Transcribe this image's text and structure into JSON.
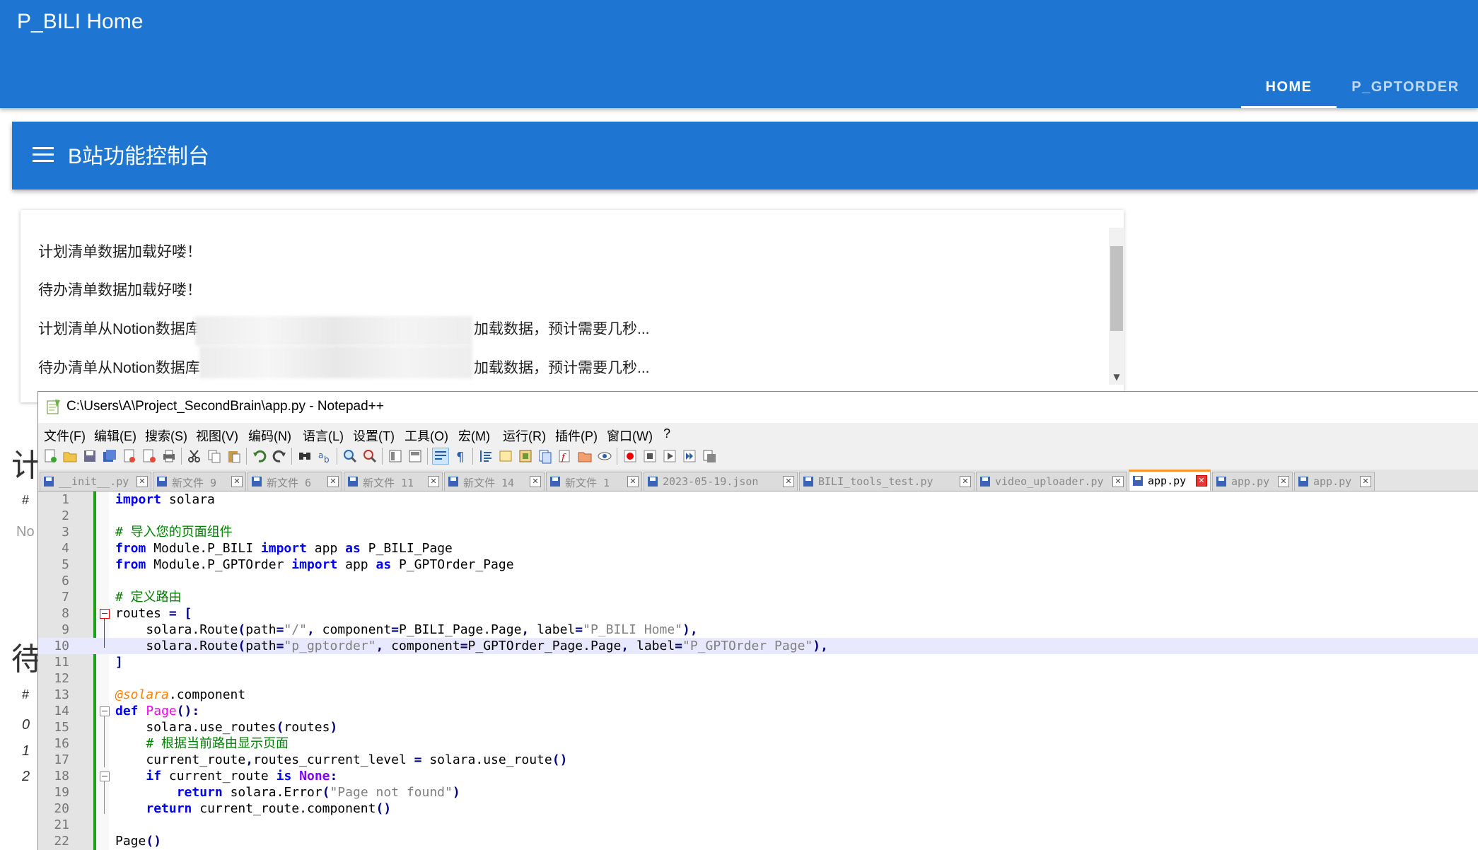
{
  "app": {
    "title": "P_BILI Home"
  },
  "nav": {
    "tabs": [
      {
        "label": "HOME"
      },
      {
        "label": "P_GPTORDER"
      }
    ]
  },
  "toolbar": {
    "title": "B站功能控制台"
  },
  "log": {
    "lines": [
      "计划清单数据加载好喽！",
      "待办清单数据加载好喽！",
      "计划清单从Notion数据库",
      "待办清单从Notion数据库"
    ],
    "line_tails": [
      "加载数据，预计需要几秒...",
      "加载数据，预计需要几秒..."
    ]
  },
  "background_fragments": {
    "heading_1": "计",
    "hash_1": "#",
    "no_1": "No",
    "heading_2": "待",
    "hash_2": "#",
    "rows": [
      "0",
      "1",
      "2"
    ]
  },
  "notepad": {
    "title": "C:\\Users\\A\\Project_SecondBrain\\app.py - Notepad++",
    "menu": [
      "文件(F)",
      "编辑(E)",
      "搜索(S)",
      "视图(V)",
      "编码(N)",
      "语言(L)",
      "设置(T)",
      "工具(O)",
      "宏(M)",
      "运行(R)",
      "插件(P)",
      "窗口(W)",
      "?"
    ],
    "tabs": [
      {
        "name": "__init__.py"
      },
      {
        "name": "新文件 9"
      },
      {
        "name": "新文件 6"
      },
      {
        "name": "新文件 11"
      },
      {
        "name": "新文件 14"
      },
      {
        "name": "新文件 1"
      },
      {
        "name": "2023-05-19.json"
      },
      {
        "name": "BILI_tools_test.py"
      },
      {
        "name": "video_uploader.py"
      },
      {
        "name": "app.py",
        "active": true
      },
      {
        "name": "app.py"
      },
      {
        "name": "app.py"
      }
    ],
    "line_numbers": [
      "1",
      "2",
      "3",
      "4",
      "5",
      "6",
      "7",
      "8",
      "9",
      "10",
      "11",
      "12",
      "13",
      "14",
      "15",
      "16",
      "17",
      "18",
      "19",
      "20",
      "21",
      "22"
    ],
    "highlighted_line": 10
  },
  "colors": {
    "primary": "#1e76d2",
    "active_tab_border": "#fa9628",
    "change_bar": "#17a517"
  }
}
